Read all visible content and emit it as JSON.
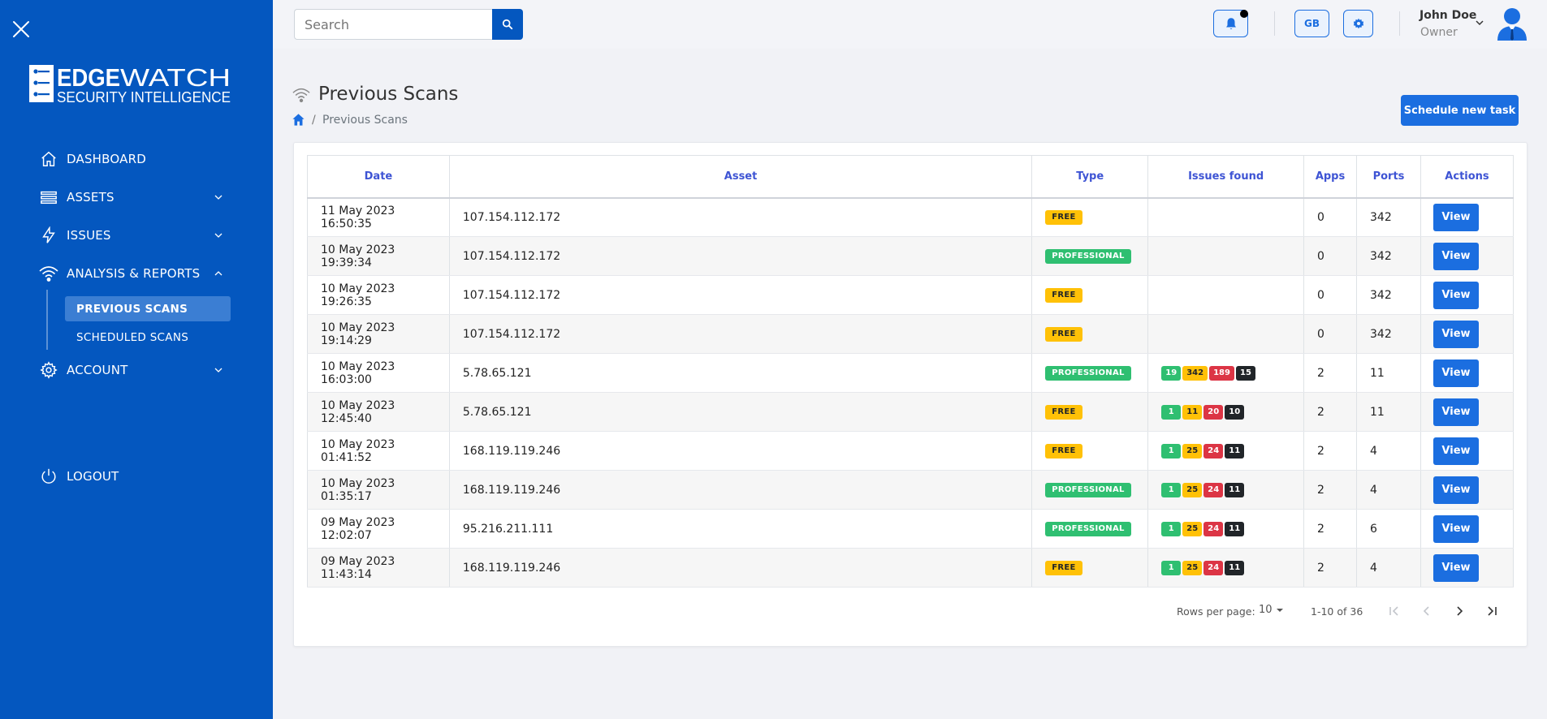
{
  "brand": {
    "line1": "EDGEWATCH",
    "line2": "SECURITY INTELLIGENCE"
  },
  "sidebar": {
    "items": [
      {
        "label": "DASHBOARD",
        "icon": "home-icon"
      },
      {
        "label": "ASSETS",
        "icon": "layers-icon"
      },
      {
        "label": "ISSUES",
        "icon": "lightning-icon"
      },
      {
        "label": "ANALYSIS & REPORTS",
        "icon": "wifi-icon"
      }
    ],
    "sub_items": [
      {
        "label": "PREVIOUS SCANS",
        "active": true
      },
      {
        "label": "SCHEDULED SCANS",
        "active": false
      }
    ],
    "account": "ACCOUNT",
    "logout": "LOGOUT"
  },
  "header": {
    "search_placeholder": "Search",
    "language": "GB",
    "user_name": "John Doe",
    "user_role": "Owner"
  },
  "page": {
    "title": "Previous Scans",
    "breadcrumb_current": "Previous Scans",
    "schedule_button": "Schedule new task"
  },
  "table": {
    "headers": [
      "Date",
      "Asset",
      "Type",
      "Issues found",
      "Apps",
      "Ports",
      "Actions"
    ],
    "rows": [
      {
        "date": "11 May 2023 16:50:35",
        "asset": "107.154.112.172",
        "type": "FREE",
        "issues": [],
        "apps": "0",
        "ports": "342"
      },
      {
        "date": "10 May 2023 19:39:34",
        "asset": "107.154.112.172",
        "type": "PROFESSIONAL",
        "issues": [],
        "apps": "0",
        "ports": "342"
      },
      {
        "date": "10 May 2023 19:26:35",
        "asset": "107.154.112.172",
        "type": "FREE",
        "issues": [],
        "apps": "0",
        "ports": "342"
      },
      {
        "date": "10 May 2023 19:14:29",
        "asset": "107.154.112.172",
        "type": "FREE",
        "issues": [],
        "apps": "0",
        "ports": "342"
      },
      {
        "date": "10 May 2023 16:03:00",
        "asset": "5.78.65.121",
        "type": "PROFESSIONAL",
        "issues": [
          "19",
          "342",
          "189",
          "15"
        ],
        "apps": "2",
        "ports": "11"
      },
      {
        "date": "10 May 2023 12:45:40",
        "asset": "5.78.65.121",
        "type": "FREE",
        "issues": [
          "1",
          "11",
          "20",
          "10"
        ],
        "apps": "2",
        "ports": "11"
      },
      {
        "date": "10 May 2023 01:41:52",
        "asset": "168.119.119.246",
        "type": "FREE",
        "issues": [
          "1",
          "25",
          "24",
          "11"
        ],
        "apps": "2",
        "ports": "4"
      },
      {
        "date": "10 May 2023 01:35:17",
        "asset": "168.119.119.246",
        "type": "PROFESSIONAL",
        "issues": [
          "1",
          "25",
          "24",
          "11"
        ],
        "apps": "2",
        "ports": "4"
      },
      {
        "date": "09 May 2023 12:02:07",
        "asset": "95.216.211.111",
        "type": "PROFESSIONAL",
        "issues": [
          "1",
          "25",
          "24",
          "11"
        ],
        "apps": "2",
        "ports": "6"
      },
      {
        "date": "09 May 2023 11:43:14",
        "asset": "168.119.119.246",
        "type": "FREE",
        "issues": [
          "1",
          "25",
          "24",
          "11"
        ],
        "apps": "2",
        "ports": "4"
      }
    ],
    "view_label": "View"
  },
  "pagination": {
    "rows_per_page_label": "Rows per page:",
    "rows_per_page": "10",
    "range": "1-10 of 36"
  },
  "colors": {
    "sidebar": "#0457bf",
    "primary": "#1b6ee0",
    "free": "#ffc107",
    "professional": "#2fbf71",
    "danger": "#dc3545",
    "dark": "#212529"
  }
}
